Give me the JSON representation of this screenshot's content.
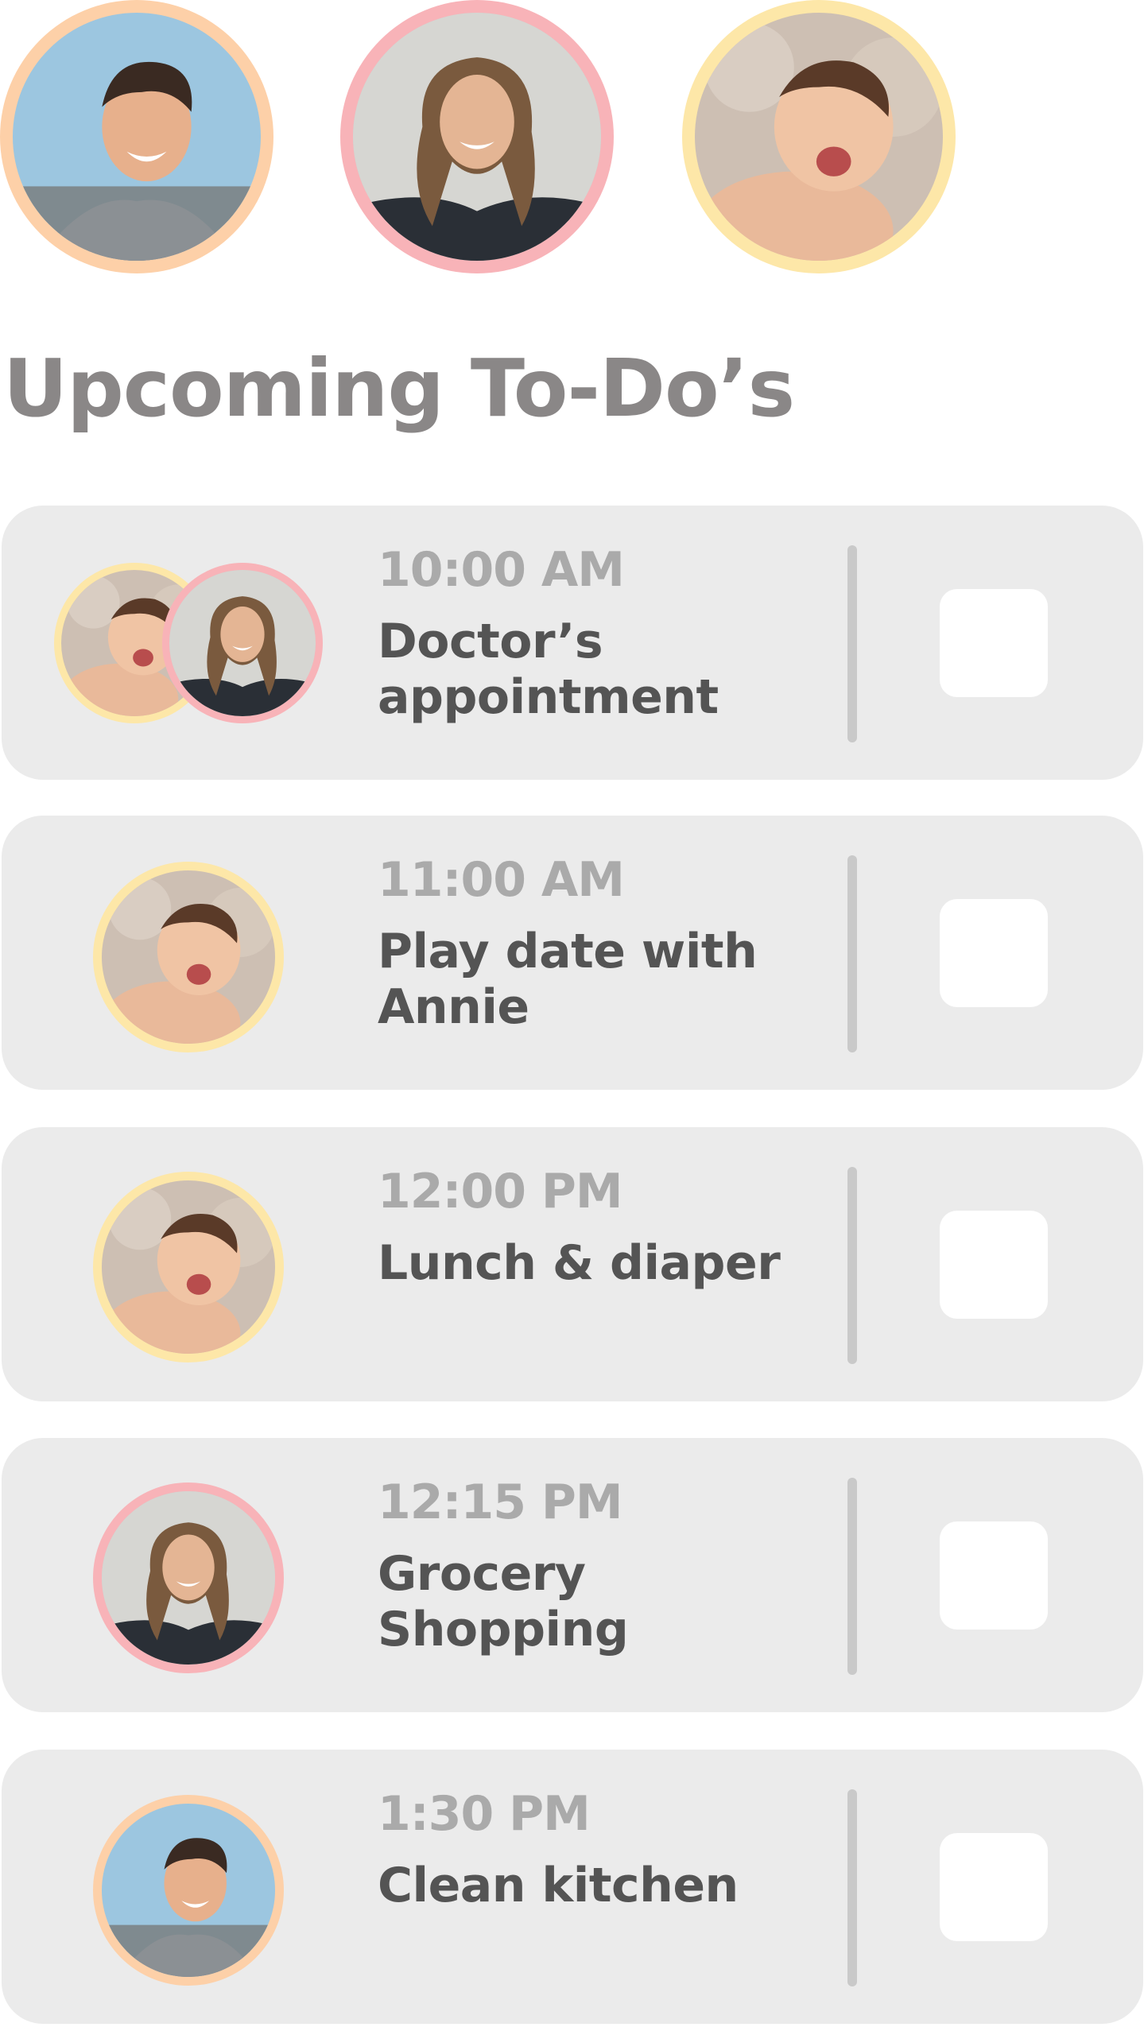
{
  "heading": "Upcoming To-Do’s",
  "colors": {
    "dad_ring": "#fdd0a8",
    "mom_ring": "#f8b3b8",
    "baby_ring": "#fde7a8",
    "card_bg": "#ebebeb",
    "time_text": "#aaaaaa",
    "title_text": "#545454",
    "heading_text": "#8a8787"
  },
  "members": [
    {
      "name": "dad-avatar",
      "ring": "peach"
    },
    {
      "name": "mom-avatar",
      "ring": "pink"
    },
    {
      "name": "baby-avatar",
      "ring": "yellow"
    }
  ],
  "todos": [
    {
      "time": "10:00 AM",
      "title": "Doctor’s appointment",
      "assignees": [
        "baby",
        "mom"
      ],
      "checked": false
    },
    {
      "time": "11:00 AM",
      "title": "Play date with Annie",
      "assignees": [
        "baby"
      ],
      "checked": false
    },
    {
      "time": "12:00 PM",
      "title": "Lunch & diaper",
      "assignees": [
        "baby"
      ],
      "checked": false
    },
    {
      "time": "12:15 PM",
      "title": "Grocery Shopping",
      "assignees": [
        "mom"
      ],
      "checked": false
    },
    {
      "time": "1:30 PM",
      "title": "Clean kitchen",
      "assignees": [
        "dad"
      ],
      "checked": false
    }
  ]
}
